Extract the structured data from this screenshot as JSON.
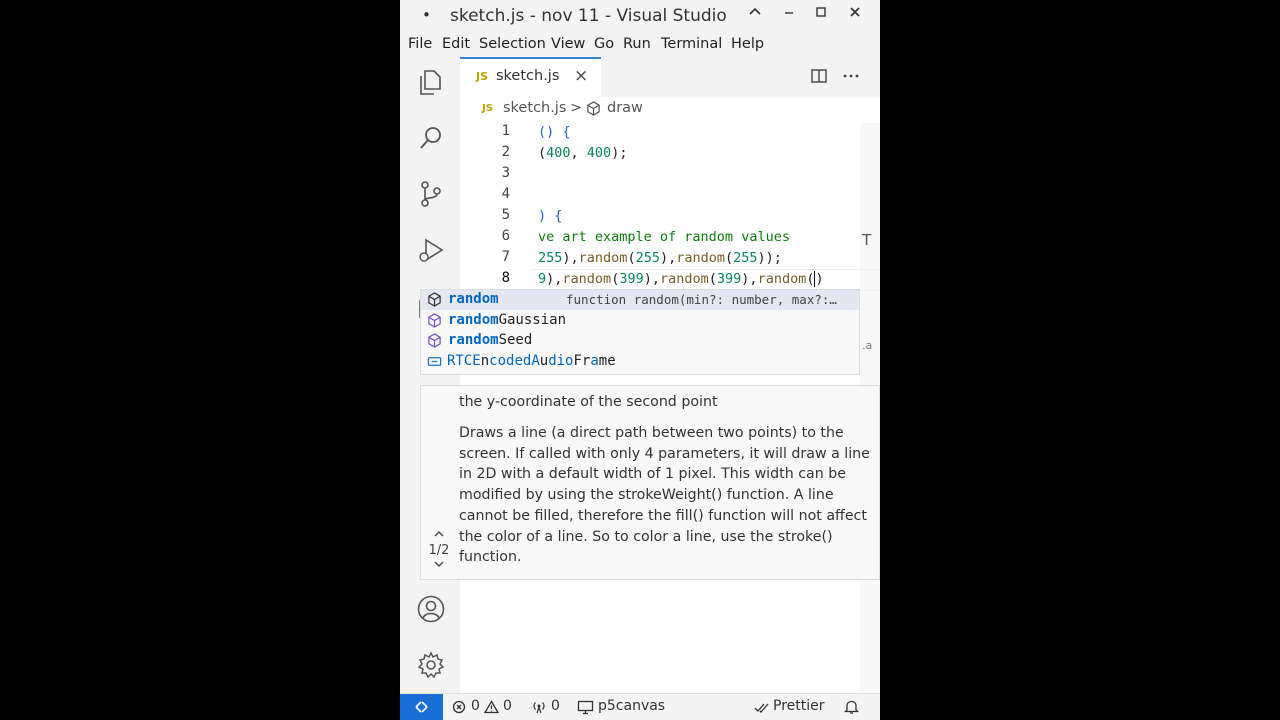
{
  "window": {
    "dirty_indicator": "•",
    "title": "sketch.js - nov 11 - Visual Studio",
    "controls": [
      "^",
      "—",
      "□",
      "×"
    ]
  },
  "menu": [
    "File",
    "Edit",
    "Selection",
    "View",
    "Go",
    "Run",
    "Terminal",
    "Help"
  ],
  "activity_bar": [
    "explorer-icon",
    "search-icon",
    "source-control-icon",
    "run-debug-icon",
    "extensions-icon",
    "accounts-icon",
    "settings-gear-icon"
  ],
  "tab": {
    "badge": "JS",
    "label": "sketch.js",
    "close": "×"
  },
  "breadcrumb": {
    "file": "sketch.js",
    "separator": ">",
    "symbol": "draw"
  },
  "editor": {
    "lines": [
      {
        "n": "1",
        "text": "() {"
      },
      {
        "n": "2",
        "text": "(400, 400);"
      },
      {
        "n": "3",
        "text": ""
      },
      {
        "n": "4",
        "text": ""
      },
      {
        "n": "5",
        "text": ") {"
      },
      {
        "n": "6",
        "text": "ve art example of random values"
      },
      {
        "n": "7",
        "text": "255),random(255),random(255));"
      },
      {
        "n": "8",
        "text": "9),random(399),random(399),random()"
      }
    ]
  },
  "suggest": {
    "items": [
      {
        "icon": "method-cube-icon",
        "match": "random",
        "rest": "",
        "detail": "function random(min?: number, max?:…"
      },
      {
        "icon": "method-cube-icon",
        "match": "random",
        "rest": "Gaussian",
        "detail": ""
      },
      {
        "icon": "method-cube-icon",
        "match": "random",
        "rest": "Seed",
        "detail": ""
      },
      {
        "icon": "variable-icon",
        "match": "",
        "rest": "RTCEncodedAudioFrame",
        "detail": ""
      }
    ]
  },
  "hover_doc": {
    "param_doc": "the y-coordinate of the second point",
    "description": "Draws a line (a direct path between two points) to the screen. If called with only 4 parameters, it will draw a line in 2D with a default width of 1 pixel. This width can be modified by using the strokeWeight() function. A line cannot be filled, therefore the fill() function will not affect the color of a line. So to color a line, use the stroke() function.",
    "page": "1/2"
  },
  "status_bar": {
    "errors": "0",
    "warnings": "0",
    "ports": "0",
    "live_server": "p5canvas",
    "formatter": "Prettier"
  },
  "colors": {
    "accent": "#1b6ed6",
    "keyword": "#1f5fc0",
    "number": "#098658",
    "function": "#795e26",
    "comment": "#0e7a0e"
  }
}
